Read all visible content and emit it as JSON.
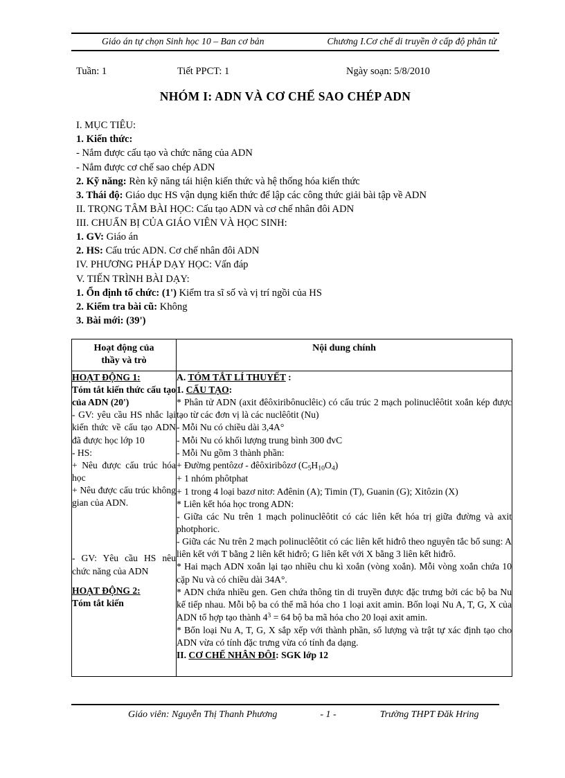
{
  "running_header": {
    "left": "Giáo án tự chọn Sinh học 10 – Ban cơ bản",
    "right": "Chương I.Cơ chế di truyền ở cấp độ phân tử"
  },
  "info_line": {
    "week": "Tuần:  1",
    "period": "Tiết PPCT: 1",
    "date": "Ngày soạn: 5/8/2010"
  },
  "doc_title": "NHÓM I: ADN VÀ CƠ CHẾ SAO CHÉP ADN",
  "outline": {
    "lines": [
      "I. MỤC TIÊU:",
      "1. Kiến thức:",
      "- Nắm được cấu tạo và chức năng của ADN",
      "- Nắm được cơ chế sao chép ADN",
      "2. Kỹ năng: Rèn kỹ năng tái hiện kiến thức và hệ thống hóa kiến thức",
      "3. Thái độ: Giáo dục HS vận dụng kiến thức để lập các công thức giải bài tập về ADN",
      "II. TRỌNG TÂM BÀI HỌC: Cấu tạo ADN và cơ chế nhân đôi ADN",
      "III. CHUẨN BỊ CỦA GIÁO VIÊN VÀ HỌC SINH:",
      "1. GV: Giáo án",
      "2. HS: Cấu trúc ADN. Cơ chế nhân đôi ADN",
      "IV. PHƯƠNG PHÁP DẠY HỌC: Vấn đáp",
      "V. TIẾN TRÌNH BÀI DẠY:",
      "1. Ổn định tổ chức: (1') Kiểm tra sĩ số và vị trí ngồi  của HS",
      "2. Kiểm tra bài cũ:  Không",
      "3. Bài mới: (39')"
    ]
  },
  "table": {
    "headers": {
      "left_line1": "Hoạt động của",
      "left_line2": "thầy và trò",
      "right": "Nội dung chính"
    },
    "left_column": {
      "activity1_heading": "HOẠT ĐỘNG 1:",
      "activity1_title": "Tóm tắt kiến thức cấu tạo của ADN (20')",
      "teacher_step": "- GV: yêu cầu HS nhắc lại kiến thức về cấu tạo ADN đã được học lớp 10",
      "student_label": "- HS:",
      "student_point1": "+ Nêu được cấu trúc hóa học",
      "student_point2": "+ Nêu được cấu trúc không gian của ADN.",
      "teacher_step2": "- GV: Yêu cầu HS nêu chức năng của ADN",
      "activity2_heading": "HOẠT ĐỘNG 2:",
      "activity2_title": "Tóm tắt kiến"
    },
    "right_column": {
      "section_a": "A. ",
      "section_a_underline": "TÓM TẮT LÍ THUYẾT",
      "section_a_tail": " :",
      "item1_num": "1. ",
      "item1_underline": "CẤU TẠO",
      "item1_tail": ":",
      "p1": "* Phân tử ADN (axit đêôxiribônuclêic)  có cấu trúc 2 mạch polinuclêôtit  xoắn kép được tạo từ các đơn vị là các nuclêôtit  (Nu)",
      "p2": "- Mỗi Nu có chiều  dài 3,4A°",
      "p3": "- Mỗi Nu có khối lượng trung bình 300 đvC",
      "p4": "- Mỗi Nu gồm 3 thành phần:",
      "p5_prefix": "+ Đường pentôzơ - đêôxiribôzơ  (C",
      "p5_sub1": "5",
      "p5_mid": "H",
      "p5_sub2": "10",
      "p5_mid2": "O",
      "p5_sub3": "4",
      "p5_suffix": ")",
      "p6": "+ 1 nhóm phôtphat",
      "p7": "+ 1 trong 4 loại bazơ nitơ: Ađênin (A); Timin  (T), Guanin  (G); Xitôzin  (X)",
      "p8": "* Liên kết hóa học trong ADN:",
      "p9": "- Giữa các Nu trên 1 mạch polinuclêôtit  có các liên kết hóa trị giữa đường và axit photphoric.",
      "p10": "- Giữa các Nu trên 2 mạch polinuclêôtit  có các liên kết hiđrô theo nguyên tắc bổ sung: A liên kết với T bằng 2 liên kết hiđrô; G liên kết với X bằng 3 liên kết hiđrô.",
      "p11": "* Hai mạch ADN xoắn lại tạo nhiều  chu kì xoắn (vòng xoắn). Mỗi vòng xoắn chứa 10 cặp Nu và có chiều  dài 34A°.",
      "p12_a": "* ADN chứa nhiều  gen. Gen chứa thông tin di truyền được đặc trưng bởi các bộ ba Nu kế tiếp nhau. Mỗi bộ ba có thể mã hóa cho 1 loại axit amin. Bốn loại Nu A, T, G, X của ADN tổ hợp tạo thành  4",
      "p12_sup": "3",
      "p12_b": " = 64 bộ ba mã hóa cho 20 loại axit amin.",
      "p13": "* Bốn loại Nu A, T, G, X sắp xếp với thành  phần, số lượng và trật tự xác định tạo cho ADN vừa có tính  đặc trưng vừa có tính  đa dạng.",
      "p14_num": "II. ",
      "p14_underline": "CƠ CHẾ NHÂN ĐÔI",
      "p14_tail": ": SGK lớp 12"
    }
  },
  "footer": {
    "teacher": "Giáo viên: Nguyễn Thị Thanh Phương",
    "page": "- 1 -",
    "school": "Trường THPT Đăk Hring"
  }
}
